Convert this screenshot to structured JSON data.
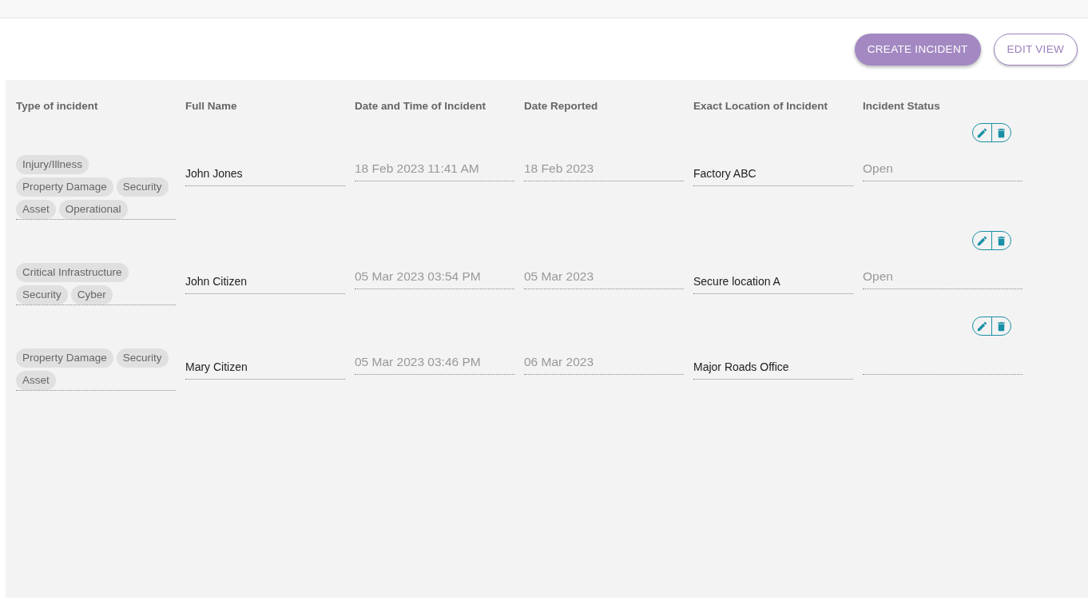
{
  "toolbar": {
    "buttons": [
      {
        "label": "CREATE INCIDENT",
        "kind": "primary"
      },
      {
        "label": "EDIT VIEW",
        "kind": "outline"
      }
    ]
  },
  "table": {
    "columns": [
      "Type of incident",
      "Full Name",
      "Date and Time of Incident",
      "Date Reported",
      "Exact Location of Incident",
      "Incident Status"
    ],
    "rows": [
      {
        "types": [
          "Injury/Illness",
          "Property Damage",
          "Security",
          "Asset",
          "Operational"
        ],
        "full_name": "John Jones",
        "incident_datetime": "18 Feb 2023 11:41 AM",
        "date_reported": "18 Feb 2023",
        "location": "Factory ABC",
        "status": "Open"
      },
      {
        "types": [
          "Critical Infrastructure",
          "Security",
          "Cyber"
        ],
        "full_name": "John Citizen",
        "incident_datetime": "05 Mar 2023 03:54 PM",
        "date_reported": "05 Mar 2023",
        "location": "Secure location A",
        "status": "Open"
      },
      {
        "types": [
          "Property Damage",
          "Security",
          "Asset"
        ],
        "full_name": "Mary Citizen",
        "incident_datetime": "05 Mar 2023 03:46 PM",
        "date_reported": "06 Mar 2023",
        "location": "Major Roads Office"
      }
    ]
  }
}
